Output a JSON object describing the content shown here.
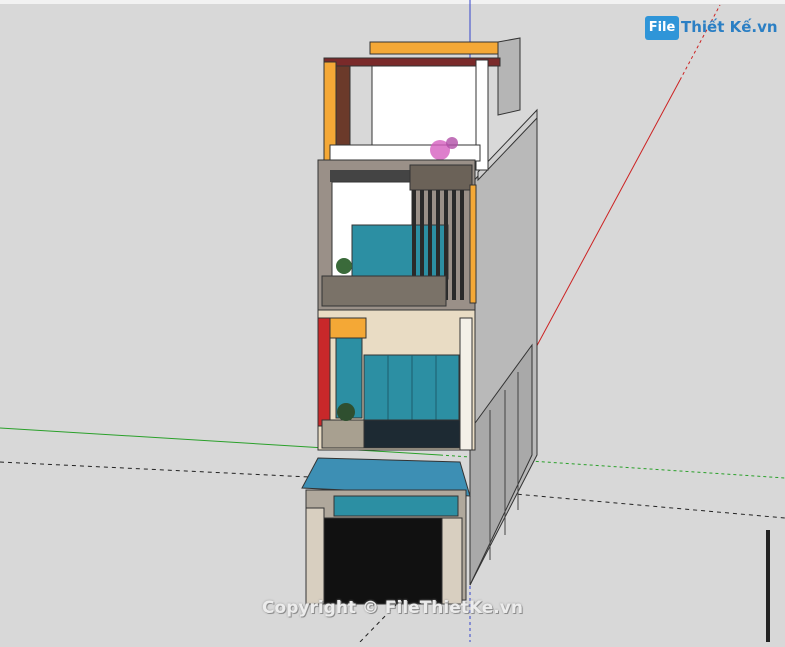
{
  "logo": {
    "badge": "File",
    "name": "Thiết Kế.vn"
  },
  "watermark": "Copyright © FileThietKe.vn",
  "colors": {
    "background": "#d8d8d8",
    "wall_side": "#b9b9b9",
    "wall_front": "#ffffff",
    "accent_orange": "#f4a836",
    "accent_red": "#c8282a",
    "glass": "#2c8fa3",
    "canopy": "#3d8fb4",
    "stone": "#7a7268",
    "garage": "#111111",
    "axis_green": "#2aa02a",
    "axis_red": "#cc2222",
    "axis_blue": "#3344cc"
  }
}
